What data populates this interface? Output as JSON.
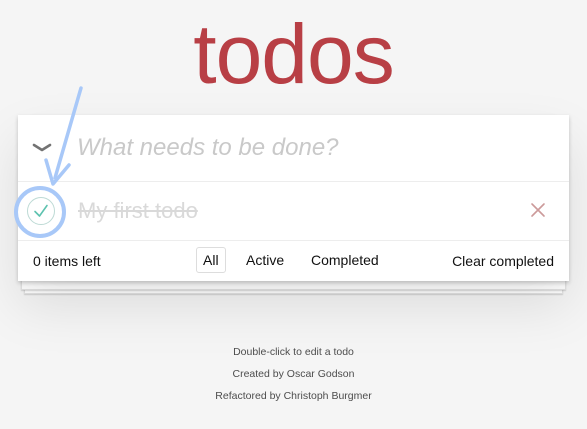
{
  "app": {
    "title": "todos"
  },
  "header": {
    "toggle_all_icon": "chevron-down-icon",
    "new_todo_placeholder": "What needs to be done?",
    "new_todo_value": ""
  },
  "todos": [
    {
      "title": "My first todo",
      "completed": true
    }
  ],
  "footer": {
    "count_text": "0 items left",
    "filters": [
      {
        "label": "All",
        "selected": true
      },
      {
        "label": "Active",
        "selected": false
      },
      {
        "label": "Completed",
        "selected": false
      }
    ],
    "clear_completed_label": "Clear completed"
  },
  "info": {
    "line1": "Double-click to edit a todo",
    "line2": "Created by Oscar Godson",
    "line3": "Refactored by Christoph Burgmer"
  },
  "colors": {
    "title": "#b83f45",
    "check": "#5dc2af",
    "destroy": "#cc9a9a",
    "annotation": "#a8c8f8"
  }
}
